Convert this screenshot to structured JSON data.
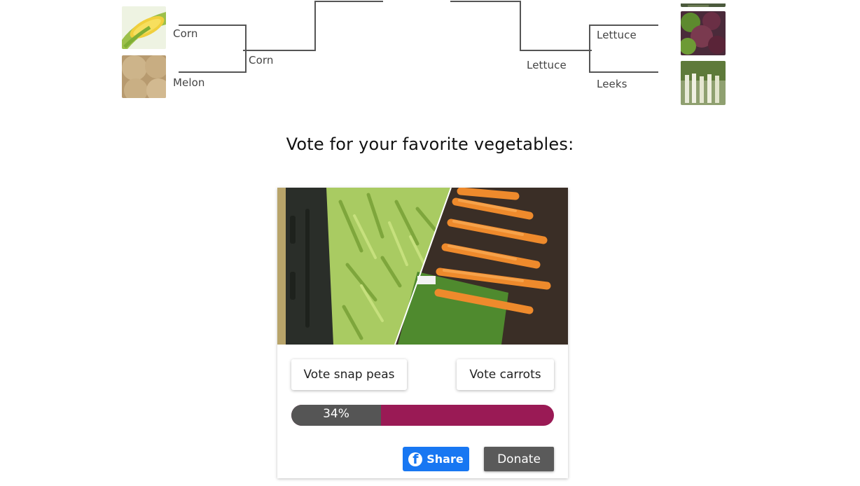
{
  "bracket": {
    "left_round1": [
      "Corn",
      "Melon"
    ],
    "left_round2": "Corn",
    "right_round1": [
      "Lettuce",
      "Leeks"
    ],
    "right_round2": "Lettuce"
  },
  "poll": {
    "title": "Vote for your favorite vegetables:",
    "option_a_button": "Vote snap peas",
    "option_b_button": "Vote carrots",
    "result_text": "34%",
    "option_a_fraction": 0.34
  },
  "actions": {
    "share_label": "Share",
    "donate_label": "Donate"
  },
  "colors": {
    "bar_a": "#555555",
    "bar_b": "#9a1a55",
    "share": "#1877f2",
    "donate": "#5a5a5a"
  }
}
